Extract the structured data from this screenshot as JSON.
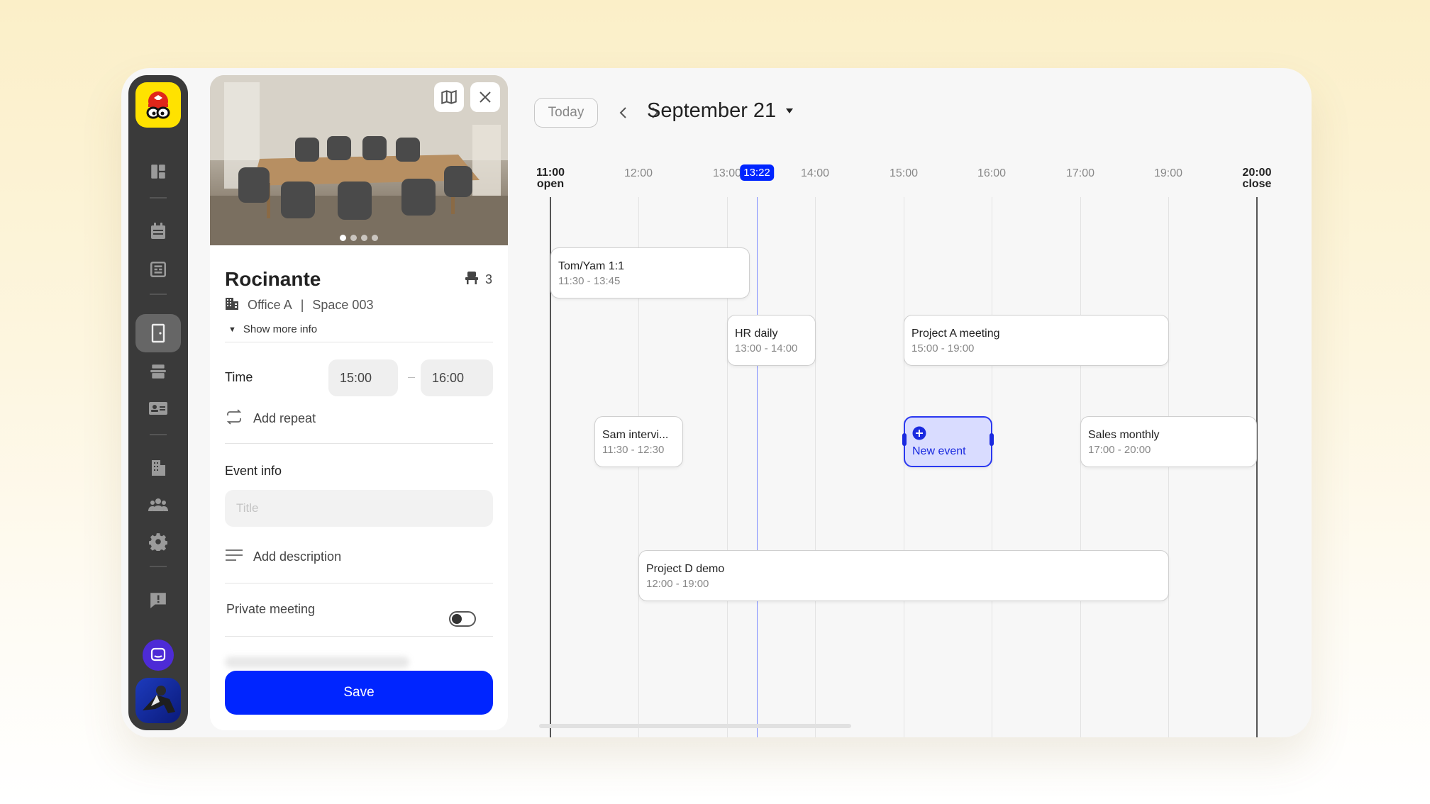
{
  "panel": {
    "room_title": "Rocinante",
    "seats": "3",
    "office": "Office A",
    "separator": "|",
    "space": "Space 003",
    "show_more": "Show more info",
    "time_label": "Time",
    "time_start": "15:00",
    "time_end": "16:00",
    "add_repeat": "Add repeat",
    "event_info": "Event info",
    "title_placeholder": "Title",
    "add_description": "Add description",
    "private_meeting": "Private meeting",
    "private_on": false,
    "save": "Save"
  },
  "calendar": {
    "today": "Today",
    "date": "September 21",
    "ticks": {
      "t1100": "11:00",
      "t1100_sub": "open",
      "t1200": "12:00",
      "t1300": "13:00",
      "now": "13:22",
      "t1400": "14:00",
      "t1500": "15:00",
      "t1600": "16:00",
      "t1700": "17:00",
      "t1900": "19:00",
      "t2000": "20:00",
      "t2000_sub": "close"
    },
    "events": {
      "tom": {
        "title": "Tom/Yam 1:1",
        "time": "11:30 - 13:45"
      },
      "hr": {
        "title": "HR daily",
        "time": "13:00 - 14:00"
      },
      "projA": {
        "title": "Project A meeting",
        "time": "15:00 - 19:00"
      },
      "sam": {
        "title": "Sam intervi...",
        "time": "11:30 - 12:30"
      },
      "newev": {
        "title": "New event"
      },
      "sales": {
        "title": "Sales monthly",
        "time": "17:00 - 20:00"
      },
      "projD": {
        "title": "Project D demo",
        "time": "12:00 - 19:00"
      }
    }
  },
  "colors": {
    "accent": "#0025ff",
    "new_event_bg": "#d9dcff",
    "sidebar": "#3a3a3a",
    "logo_bg": "#ffe200"
  }
}
